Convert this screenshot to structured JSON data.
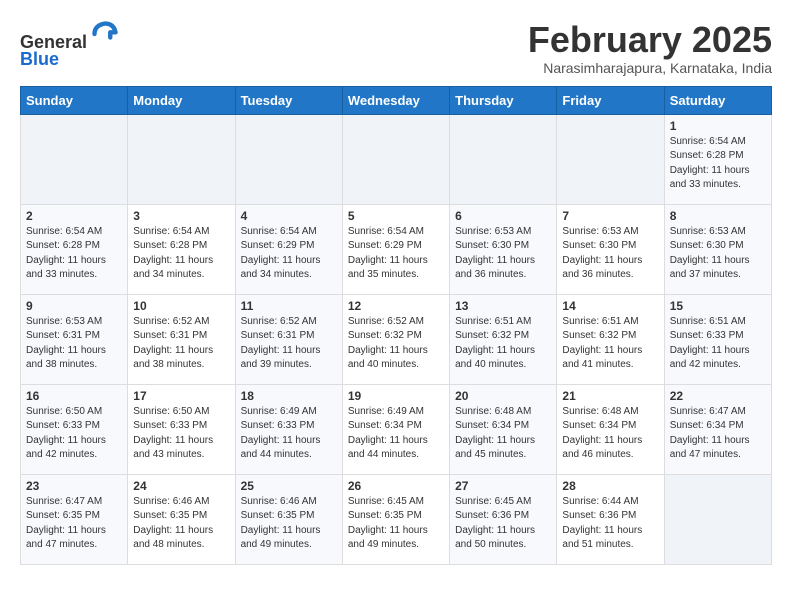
{
  "header": {
    "logo_line1": "General",
    "logo_line2": "Blue",
    "month_title": "February 2025",
    "location": "Narasimharajapura, Karnataka, India"
  },
  "days_of_week": [
    "Sunday",
    "Monday",
    "Tuesday",
    "Wednesday",
    "Thursday",
    "Friday",
    "Saturday"
  ],
  "weeks": [
    {
      "days": [
        {
          "num": "",
          "info": ""
        },
        {
          "num": "",
          "info": ""
        },
        {
          "num": "",
          "info": ""
        },
        {
          "num": "",
          "info": ""
        },
        {
          "num": "",
          "info": ""
        },
        {
          "num": "",
          "info": ""
        },
        {
          "num": "1",
          "info": "Sunrise: 6:54 AM\nSunset: 6:28 PM\nDaylight: 11 hours\nand 33 minutes."
        }
      ]
    },
    {
      "days": [
        {
          "num": "2",
          "info": "Sunrise: 6:54 AM\nSunset: 6:28 PM\nDaylight: 11 hours\nand 33 minutes."
        },
        {
          "num": "3",
          "info": "Sunrise: 6:54 AM\nSunset: 6:28 PM\nDaylight: 11 hours\nand 34 minutes."
        },
        {
          "num": "4",
          "info": "Sunrise: 6:54 AM\nSunset: 6:29 PM\nDaylight: 11 hours\nand 34 minutes."
        },
        {
          "num": "5",
          "info": "Sunrise: 6:54 AM\nSunset: 6:29 PM\nDaylight: 11 hours\nand 35 minutes."
        },
        {
          "num": "6",
          "info": "Sunrise: 6:53 AM\nSunset: 6:30 PM\nDaylight: 11 hours\nand 36 minutes."
        },
        {
          "num": "7",
          "info": "Sunrise: 6:53 AM\nSunset: 6:30 PM\nDaylight: 11 hours\nand 36 minutes."
        },
        {
          "num": "8",
          "info": "Sunrise: 6:53 AM\nSunset: 6:30 PM\nDaylight: 11 hours\nand 37 minutes."
        }
      ]
    },
    {
      "days": [
        {
          "num": "9",
          "info": "Sunrise: 6:53 AM\nSunset: 6:31 PM\nDaylight: 11 hours\nand 38 minutes."
        },
        {
          "num": "10",
          "info": "Sunrise: 6:52 AM\nSunset: 6:31 PM\nDaylight: 11 hours\nand 38 minutes."
        },
        {
          "num": "11",
          "info": "Sunrise: 6:52 AM\nSunset: 6:31 PM\nDaylight: 11 hours\nand 39 minutes."
        },
        {
          "num": "12",
          "info": "Sunrise: 6:52 AM\nSunset: 6:32 PM\nDaylight: 11 hours\nand 40 minutes."
        },
        {
          "num": "13",
          "info": "Sunrise: 6:51 AM\nSunset: 6:32 PM\nDaylight: 11 hours\nand 40 minutes."
        },
        {
          "num": "14",
          "info": "Sunrise: 6:51 AM\nSunset: 6:32 PM\nDaylight: 11 hours\nand 41 minutes."
        },
        {
          "num": "15",
          "info": "Sunrise: 6:51 AM\nSunset: 6:33 PM\nDaylight: 11 hours\nand 42 minutes."
        }
      ]
    },
    {
      "days": [
        {
          "num": "16",
          "info": "Sunrise: 6:50 AM\nSunset: 6:33 PM\nDaylight: 11 hours\nand 42 minutes."
        },
        {
          "num": "17",
          "info": "Sunrise: 6:50 AM\nSunset: 6:33 PM\nDaylight: 11 hours\nand 43 minutes."
        },
        {
          "num": "18",
          "info": "Sunrise: 6:49 AM\nSunset: 6:33 PM\nDaylight: 11 hours\nand 44 minutes."
        },
        {
          "num": "19",
          "info": "Sunrise: 6:49 AM\nSunset: 6:34 PM\nDaylight: 11 hours\nand 44 minutes."
        },
        {
          "num": "20",
          "info": "Sunrise: 6:48 AM\nSunset: 6:34 PM\nDaylight: 11 hours\nand 45 minutes."
        },
        {
          "num": "21",
          "info": "Sunrise: 6:48 AM\nSunset: 6:34 PM\nDaylight: 11 hours\nand 46 minutes."
        },
        {
          "num": "22",
          "info": "Sunrise: 6:47 AM\nSunset: 6:34 PM\nDaylight: 11 hours\nand 47 minutes."
        }
      ]
    },
    {
      "days": [
        {
          "num": "23",
          "info": "Sunrise: 6:47 AM\nSunset: 6:35 PM\nDaylight: 11 hours\nand 47 minutes."
        },
        {
          "num": "24",
          "info": "Sunrise: 6:46 AM\nSunset: 6:35 PM\nDaylight: 11 hours\nand 48 minutes."
        },
        {
          "num": "25",
          "info": "Sunrise: 6:46 AM\nSunset: 6:35 PM\nDaylight: 11 hours\nand 49 minutes."
        },
        {
          "num": "26",
          "info": "Sunrise: 6:45 AM\nSunset: 6:35 PM\nDaylight: 11 hours\nand 49 minutes."
        },
        {
          "num": "27",
          "info": "Sunrise: 6:45 AM\nSunset: 6:36 PM\nDaylight: 11 hours\nand 50 minutes."
        },
        {
          "num": "28",
          "info": "Sunrise: 6:44 AM\nSunset: 6:36 PM\nDaylight: 11 hours\nand 51 minutes."
        },
        {
          "num": "",
          "info": ""
        }
      ]
    }
  ]
}
